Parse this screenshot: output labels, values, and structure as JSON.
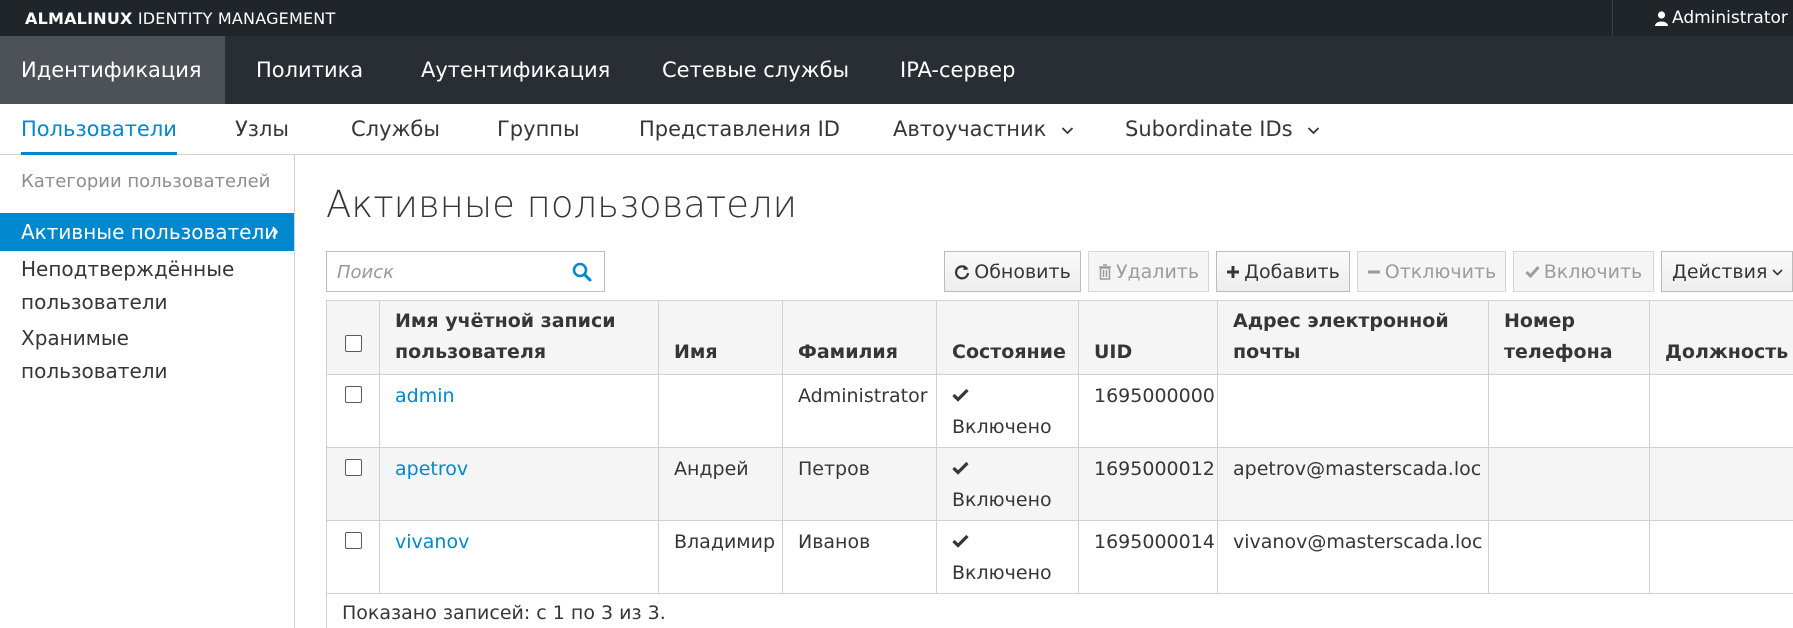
{
  "topbar": {
    "brand_bold": "ALMALINUX",
    "brand_rest": " IDENTITY MANAGEMENT",
    "user": "Administrator"
  },
  "main_nav": [
    {
      "label": "Идентификация",
      "active": true
    },
    {
      "label": "Политика"
    },
    {
      "label": "Аутентификация"
    },
    {
      "label": "Сетевые службы"
    },
    {
      "label": "IPA-сервер"
    }
  ],
  "sub_nav": [
    {
      "label": "Пользователи",
      "active": true
    },
    {
      "label": "Узлы"
    },
    {
      "label": "Службы"
    },
    {
      "label": "Группы"
    },
    {
      "label": "Представления ID"
    },
    {
      "label": "Автоучастник",
      "dropdown": true
    },
    {
      "label": "Subordinate IDs",
      "dropdown": true
    }
  ],
  "sidebar": {
    "heading": "Категории пользователей",
    "items": [
      {
        "label": "Активные пользователи",
        "active": true
      },
      {
        "label": "Неподтверждённые пользователи"
      },
      {
        "label": "Хранимые пользователи"
      }
    ]
  },
  "page_title": "Активные пользователи",
  "search": {
    "placeholder": "Поиск"
  },
  "toolbar": {
    "refresh": "Обновить",
    "delete": "Удалить",
    "add": "Добавить",
    "disable": "Отключить",
    "enable": "Включить",
    "actions": "Действия"
  },
  "table": {
    "headers": {
      "login": "Имя учётной записи пользователя",
      "first": "Имя",
      "last": "Фамилия",
      "status": "Состояние",
      "uid": "UID",
      "email": "Адрес электронной почты",
      "phone": "Номер телефона",
      "title": "Должность"
    },
    "rows": [
      {
        "login": "admin",
        "first": "",
        "last": "Administrator",
        "status": "Включено",
        "uid": "1695000000",
        "email": "",
        "phone": "",
        "title": ""
      },
      {
        "login": "apetrov",
        "first": "Андрей",
        "last": "Петров",
        "status": "Включено",
        "uid": "1695000012",
        "email": "apetrov@masterscada.loc",
        "phone": "",
        "title": ""
      },
      {
        "login": "vivanov",
        "first": "Владимир",
        "last": "Иванов",
        "status": "Включено",
        "uid": "1695000014",
        "email": "vivanov@masterscada.loc",
        "phone": "",
        "title": ""
      }
    ],
    "footer": "Показано записей: с 1 по 3 из 3."
  },
  "colors": {
    "topbar_bg": "#1f2529",
    "nav_bg": "#292e34",
    "nav_active_bg": "#4d5258",
    "accent": "#0088ce"
  }
}
